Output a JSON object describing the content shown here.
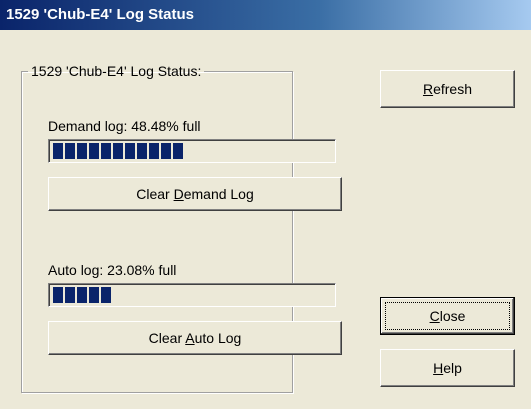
{
  "window": {
    "title": "1529 'Chub-E4' Log Status"
  },
  "group": {
    "legend": "1529 'Chub-E4' Log Status:"
  },
  "demand": {
    "label": "Demand log: 48.48% full",
    "fill_percent": 48.48,
    "button": {
      "pre": "Clear ",
      "mnemonic": "D",
      "post": "emand Log"
    }
  },
  "auto": {
    "label": "Auto log: 23.08% full",
    "fill_percent": 23.08,
    "button": {
      "pre": "Clear ",
      "mnemonic": "A",
      "post": "uto Log"
    }
  },
  "buttons": {
    "refresh": {
      "pre": "",
      "mnemonic": "R",
      "post": "efresh"
    },
    "close": {
      "pre": "",
      "mnemonic": "C",
      "post": "lose"
    },
    "help": {
      "pre": "",
      "mnemonic": "H",
      "post": "elp"
    }
  },
  "colors": {
    "progress_fill": "#0a246a",
    "title_bar": "#0a246a",
    "dialog_bg": "#ece9d8"
  }
}
